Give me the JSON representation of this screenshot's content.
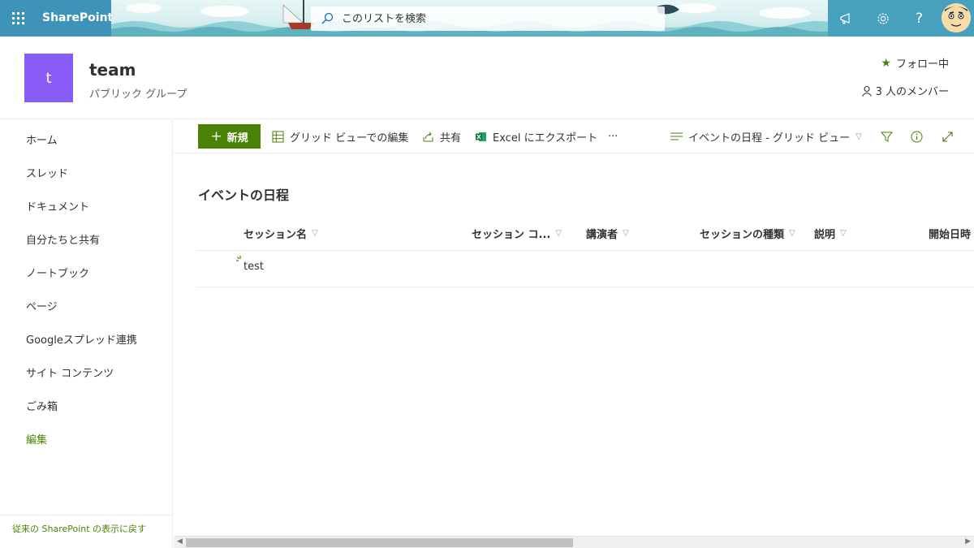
{
  "suite": {
    "brand": "SharePoint",
    "search_placeholder": "このリストを検索"
  },
  "site": {
    "logo_letter": "t",
    "title": "team",
    "subtitle": "パブリック グループ",
    "follow": "フォロー中",
    "members": "3 人のメンバー"
  },
  "nav": {
    "items": [
      {
        "label": "ホーム"
      },
      {
        "label": "スレッド"
      },
      {
        "label": "ドキュメント"
      },
      {
        "label": "自分たちと共有"
      },
      {
        "label": "ノートブック"
      },
      {
        "label": "ページ"
      },
      {
        "label": "Googleスプレッド連携"
      },
      {
        "label": "サイト コンテンツ"
      },
      {
        "label": "ごみ箱"
      }
    ],
    "edit": "編集",
    "classic": "従来の SharePoint の表示に戻す"
  },
  "commands": {
    "new": "新規",
    "grid_edit": "グリッド ビューでの編集",
    "share": "共有",
    "export": "Excel にエクスポート",
    "more": "···",
    "view": "イベントの日程 - グリッド ビュー"
  },
  "list": {
    "title": "イベントの日程",
    "columns": [
      "セッション名",
      "セッション コ...",
      "講演者",
      "セッションの種類",
      "説明",
      "開始日時"
    ],
    "rows": [
      {
        "name": "test"
      }
    ]
  },
  "colors": {
    "accent": "#498205",
    "suitebar": "#3f93b8",
    "logo": "#8a5cf7"
  }
}
